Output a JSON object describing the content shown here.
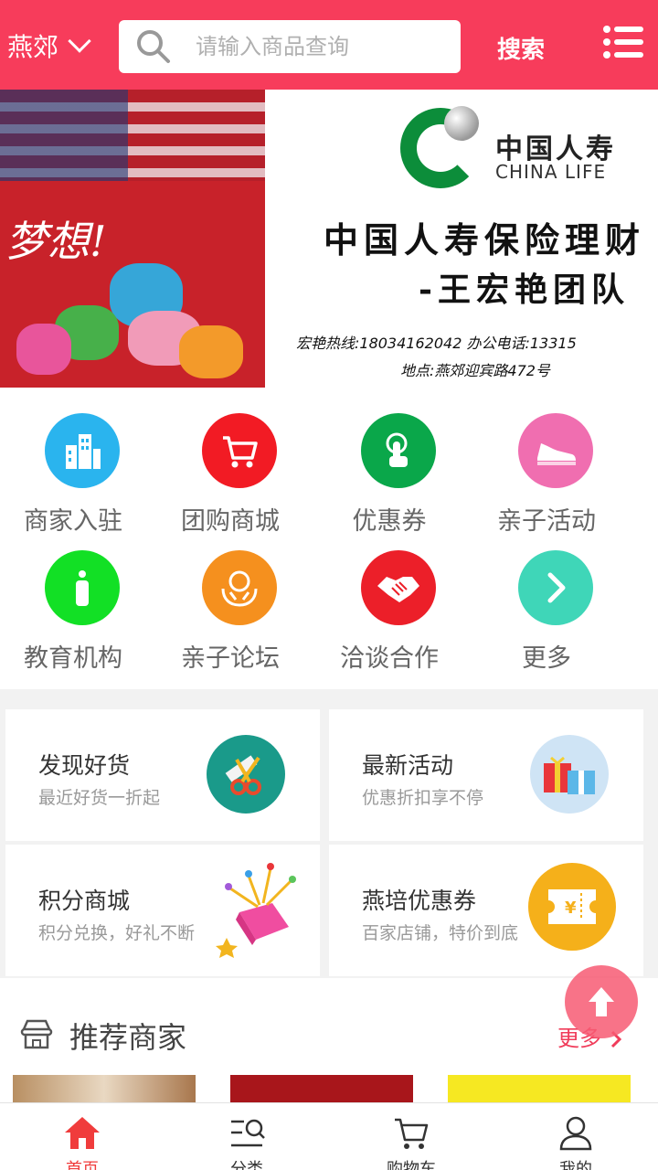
{
  "header": {
    "location": "燕郊",
    "search_placeholder": "请输入商品查询",
    "search_button": "搜索"
  },
  "banner": {
    "left_handwriting": "梦想!",
    "logo_cn": "中国人寿",
    "logo_en": "CHINA LIFE",
    "line1": "中国人寿保险理财",
    "line2": "-王宏艳团队",
    "line3": "宏艳热线:18034162042   办公电话:13315",
    "line4": "地点:燕郊迎宾路472号"
  },
  "grid": [
    {
      "label": "商家入驻",
      "color": "#2ab4ee",
      "icon": "building-icon"
    },
    {
      "label": "团购商城",
      "color": "#f21b24",
      "icon": "cart-icon"
    },
    {
      "label": "优惠券",
      "color": "#0aa74a",
      "icon": "touch-icon"
    },
    {
      "label": "亲子活动",
      "color": "#f06eb0",
      "icon": "shoe-icon"
    },
    {
      "label": "教育机构",
      "color": "#12e025",
      "icon": "bottle-icon"
    },
    {
      "label": "亲子论坛",
      "color": "#f5901e",
      "icon": "care-icon"
    },
    {
      "label": "洽谈合作",
      "color": "#ec1f29",
      "icon": "handshake-icon"
    },
    {
      "label": "更多",
      "color": "#3fd6b8",
      "icon": "chevron-right-icon"
    }
  ],
  "cards": [
    {
      "title": "发现好货",
      "sub": "最近好货一折起",
      "icon": "scissors-comb-icon"
    },
    {
      "title": "最新活动",
      "sub": "优惠折扣享不停",
      "icon": "gift-boxes-icon"
    },
    {
      "title": "积分商城",
      "sub": "积分兑换，好礼不断",
      "icon": "gift-burst-icon"
    },
    {
      "title": "燕培优惠券",
      "sub": "百家店铺，特价到底",
      "icon": "coupon-icon"
    }
  ],
  "recommend": {
    "title": "推荐商家",
    "more": "更多"
  },
  "tabbar": [
    {
      "label": "首页",
      "icon": "home-icon",
      "active": true
    },
    {
      "label": "分类",
      "icon": "category-icon",
      "active": false
    },
    {
      "label": "购物车",
      "icon": "cart-icon",
      "active": false
    },
    {
      "label": "我的",
      "icon": "user-icon",
      "active": false
    }
  ],
  "colors": {
    "brand": "#f73c5b",
    "active_tab": "#f03c3c"
  }
}
